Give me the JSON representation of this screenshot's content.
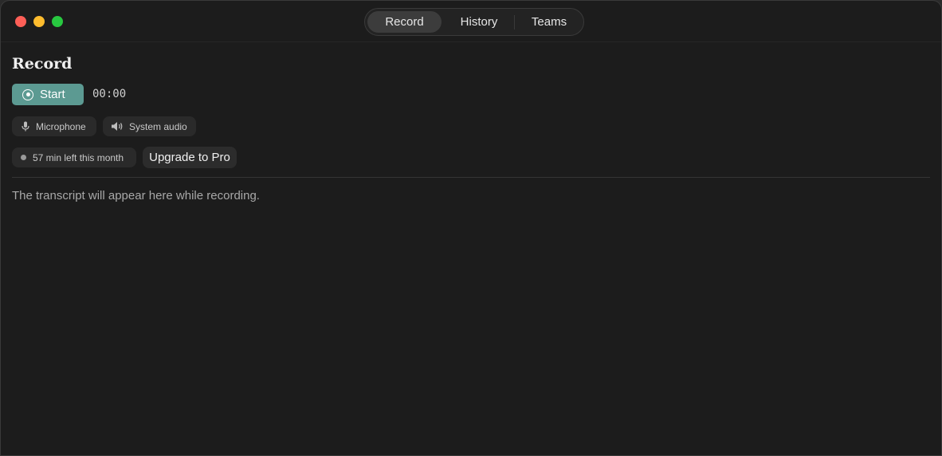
{
  "tabs": [
    {
      "label": "Record",
      "active": true
    },
    {
      "label": "History",
      "active": false
    },
    {
      "label": "Teams",
      "active": false
    }
  ],
  "page": {
    "title": "Record"
  },
  "recorder": {
    "start_label": "Start",
    "timer": "00:00",
    "sources": {
      "microphone_label": "Microphone",
      "system_audio_label": "System audio"
    },
    "quota_label": "57 min left this month",
    "upgrade_label": "Upgrade to Pro"
  },
  "transcript": {
    "placeholder": "The transcript will appear here while recording."
  },
  "icons": {
    "start": "record-icon",
    "microphone": "microphone-icon",
    "system_audio": "speaker-icon",
    "quota": "status-dot-icon"
  },
  "colors": {
    "accent": "#5c9a92",
    "background": "#1c1c1c",
    "close": "#fe5f57",
    "minimize": "#febc2e",
    "zoom": "#28c840"
  }
}
